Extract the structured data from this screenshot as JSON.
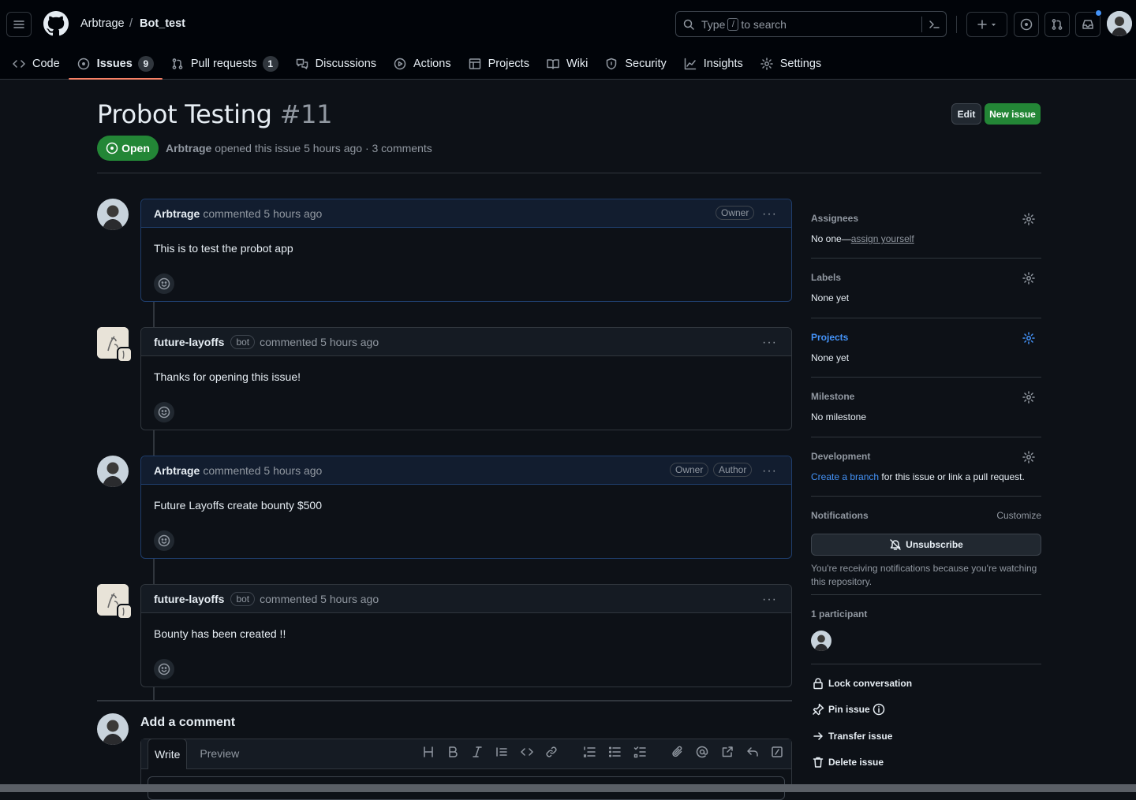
{
  "header": {
    "owner": "Arbtrage",
    "separator": "/",
    "repo": "Bot_test",
    "search_prefix": "Type",
    "search_key": "/",
    "search_suffix": "to search"
  },
  "tabs": [
    {
      "label": "Code"
    },
    {
      "label": "Issues",
      "count": "9"
    },
    {
      "label": "Pull requests",
      "count": "1"
    },
    {
      "label": "Discussions"
    },
    {
      "label": "Actions"
    },
    {
      "label": "Projects"
    },
    {
      "label": "Wiki"
    },
    {
      "label": "Security"
    },
    {
      "label": "Insights"
    },
    {
      "label": "Settings"
    }
  ],
  "issue": {
    "title": "Probot Testing",
    "number": "#11",
    "state": "Open",
    "author": "Arbtrage",
    "meta": "opened this issue 5 hours ago · 3 comments",
    "edit_label": "Edit",
    "new_issue_label": "New issue"
  },
  "comments": [
    {
      "author": "Arbtrage",
      "time": "commented 5 hours ago",
      "owner_badge": "Owner",
      "body": "This is to test the probot app"
    },
    {
      "author": "future-layoffs",
      "bot": "bot",
      "time": "commented 5 hours ago",
      "body": "Thanks for opening this issue!"
    },
    {
      "author": "Arbtrage",
      "time": "commented 5 hours ago",
      "owner_badge": "Owner",
      "author_badge": "Author",
      "body": "Future Layoffs create bounty $500"
    },
    {
      "author": "future-layoffs",
      "bot": "bot",
      "time": "commented 5 hours ago",
      "body": "Bounty has been created !!"
    }
  ],
  "add_comment": {
    "heading": "Add a comment",
    "write": "Write",
    "preview": "Preview"
  },
  "sidebar": {
    "assignees": {
      "heading": "Assignees",
      "prefix": "No one—",
      "link": "assign yourself"
    },
    "labels": {
      "heading": "Labels",
      "value": "None yet"
    },
    "projects": {
      "heading": "Projects",
      "value": "None yet"
    },
    "milestone": {
      "heading": "Milestone",
      "value": "No milestone"
    },
    "development": {
      "heading": "Development",
      "link": "Create a branch",
      "suffix": "for this issue or link a pull request."
    },
    "notifications": {
      "heading": "Notifications",
      "customize": "Customize",
      "button": "Unsubscribe",
      "note": "You're receiving notifications because you're watching this repository."
    },
    "participants": {
      "heading": "1 participant"
    },
    "actions": {
      "lock": "Lock conversation",
      "pin": "Pin issue",
      "transfer": "Transfer issue",
      "delete": "Delete issue"
    }
  },
  "colors": {
    "accent": "#4493f8",
    "open": "#238636",
    "active_tab": "#f78166"
  }
}
